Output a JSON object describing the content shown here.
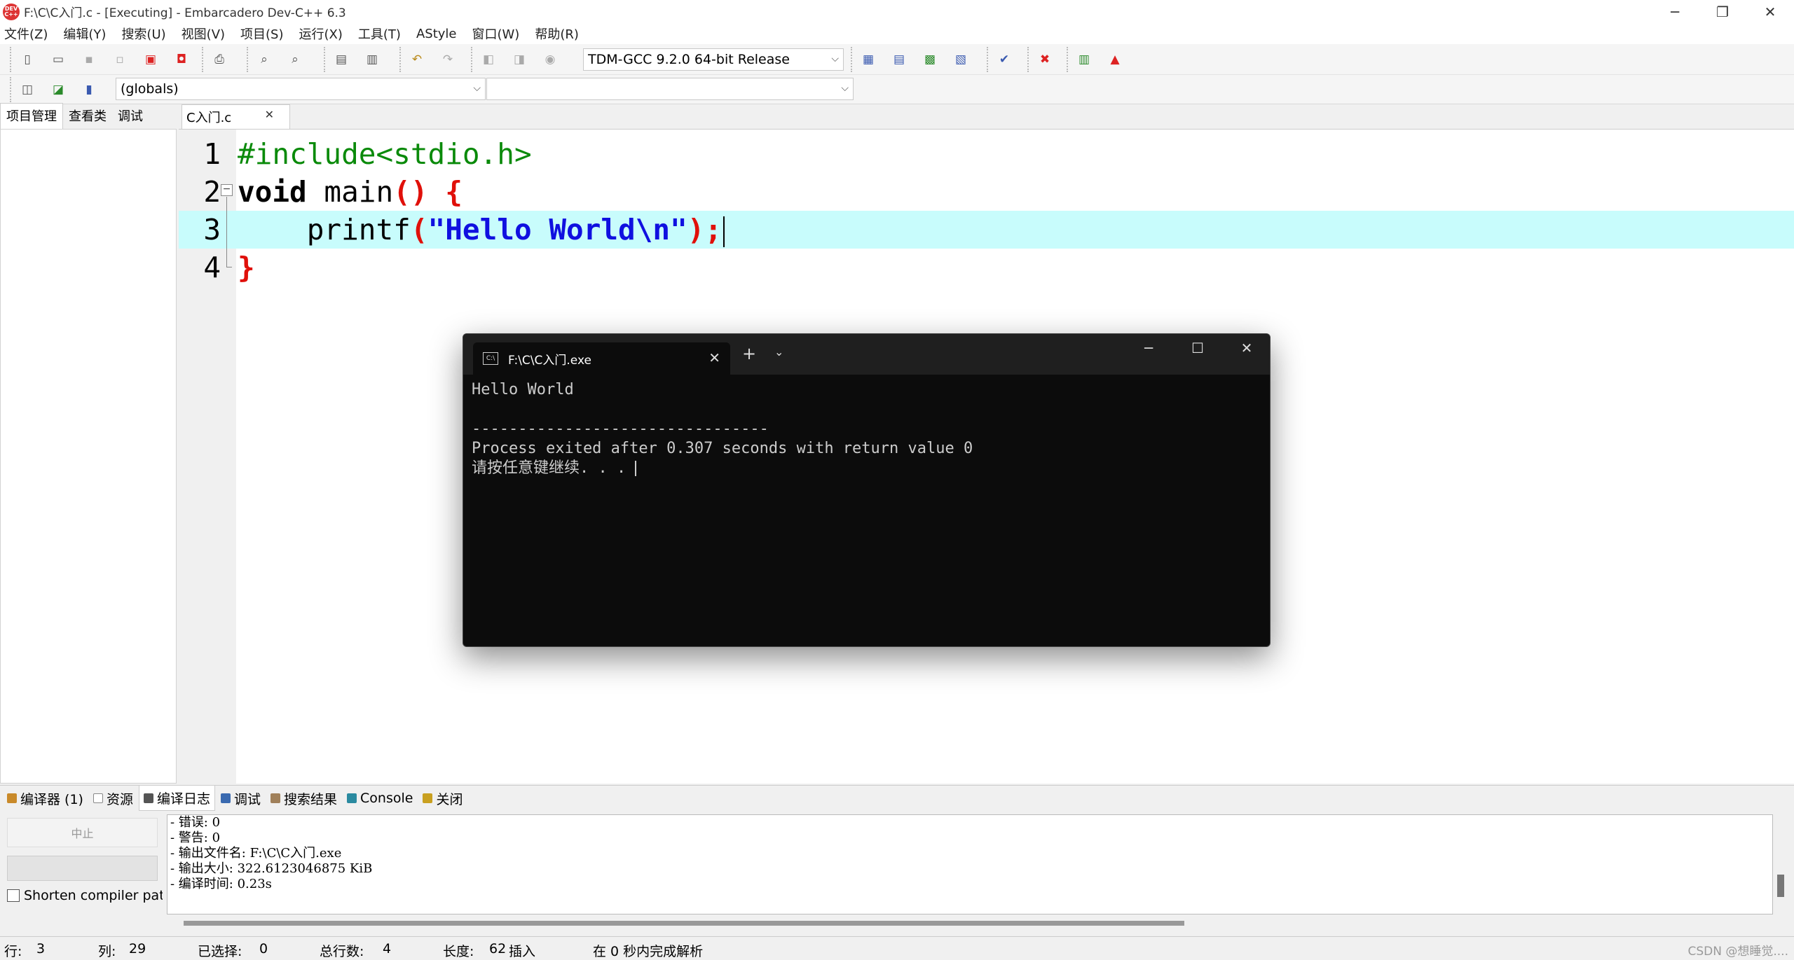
{
  "window": {
    "title": "F:\\C\\C入门.c - [Executing] - Embarcadero Dev-C++ 6.3",
    "logo": "DEV C++",
    "controls": [
      "─",
      "❐",
      "✕"
    ]
  },
  "menu": [
    "文件(Z)",
    "编辑(Y)",
    "搜索(U)",
    "视图(V)",
    "项目(S)",
    "运行(X)",
    "工具(T)",
    "AStyle",
    "窗口(W)",
    "帮助(R)"
  ],
  "toolbar": {
    "compiler": "TDM-GCC 9.2.0 64-bit Release",
    "scope": "(globals)",
    "function": ""
  },
  "left_tabs": [
    "项目管理",
    "查看类",
    "调试"
  ],
  "editor": {
    "file_tab": "C入门.c",
    "lines": [
      {
        "num": "1",
        "parts": [
          {
            "t": "#include<stdio.h>",
            "c": "c-pre"
          }
        ]
      },
      {
        "num": "2",
        "parts": [
          {
            "t": "void",
            "c": "c-kw"
          },
          {
            "t": " main",
            "c": "c-fn"
          },
          {
            "t": "() {",
            "c": "c-br"
          }
        ]
      },
      {
        "num": "3",
        "parts": [
          {
            "t": "    printf",
            "c": "c-fn"
          },
          {
            "t": "(",
            "c": "c-br"
          },
          {
            "t": "\"Hello World\\n\"",
            "c": "c-str"
          },
          {
            "t": ");",
            "c": "c-br"
          }
        ]
      },
      {
        "num": "4",
        "parts": [
          {
            "t": "}",
            "c": "c-br"
          }
        ]
      }
    ]
  },
  "console": {
    "title": "F:\\C\\C入门.exe",
    "icon_label": "C:\\",
    "output": "Hello World\n\n--------------------------------\nProcess exited after 0.307 seconds with return value 0\n请按任意键继续. . . ",
    "new_tab": "+",
    "dropdown": "⌄",
    "controls": [
      "─",
      "☐",
      "✕"
    ]
  },
  "bottom": {
    "tabs": [
      {
        "label": "编译器 (1)",
        "color": "#c98a2a"
      },
      {
        "label": "资源",
        "color": "#888888"
      },
      {
        "label": "编译日志",
        "color": "#555555"
      },
      {
        "label": "调试",
        "color": "#3a6ab0"
      },
      {
        "label": "搜索结果",
        "color": "#a0805a"
      },
      {
        "label": "Console",
        "color": "#2a8aa0"
      },
      {
        "label": "关闭",
        "color": "#c9a020"
      }
    ],
    "abort": "中止",
    "shorten": "Shorten compiler paths",
    "log": "- 错误: 0\n- 警告: 0\n- 输出文件名: F:\\C\\C入门.exe\n- 输出大小: 322.6123046875 KiB\n- 编译时间: 0.23s"
  },
  "status": {
    "row_label": "行:",
    "row": "3",
    "col_label": "列:",
    "col": "29",
    "sel_label": "已选择:",
    "sel": "0",
    "total_label": "总行数:",
    "total": "4",
    "len_label": "长度:",
    "len": "62",
    "mode": "插入",
    "parse": "在 0 秒内完成解析",
    "watermark": "CSDN @想睡觉...."
  }
}
